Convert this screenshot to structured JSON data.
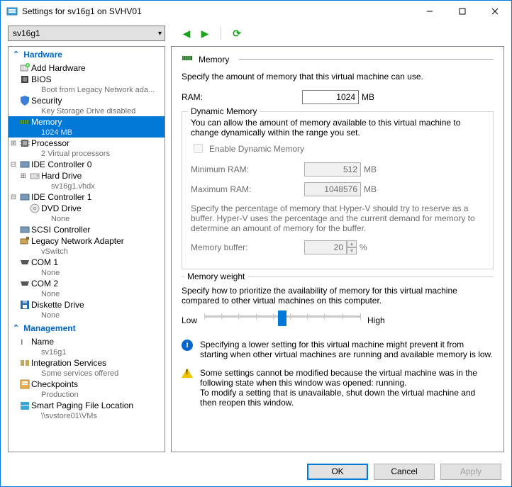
{
  "window": {
    "title": "Settings for sv16g1 on SVHV01"
  },
  "toolbar": {
    "selected_vm": "sv16g1"
  },
  "sections": {
    "hardware": "Hardware",
    "management": "Management"
  },
  "tree": {
    "add_hardware": "Add Hardware",
    "bios": "BIOS",
    "bios_sub": "Boot from Legacy Network ada...",
    "security": "Security",
    "security_sub": "Key Storage Drive disabled",
    "memory": "Memory",
    "memory_sub": "1024 MB",
    "processor": "Processor",
    "processor_sub": "2 Virtual processors",
    "ide0": "IDE Controller 0",
    "hard_drive": "Hard Drive",
    "hard_drive_sub": "sv16g1.vhdx",
    "ide1": "IDE Controller 1",
    "dvd": "DVD Drive",
    "dvd_sub": "None",
    "scsi": "SCSI Controller",
    "legacy_net": "Legacy Network Adapter",
    "legacy_net_sub": "vSwitch",
    "com1": "COM 1",
    "com1_sub": "None",
    "com2": "COM 2",
    "com2_sub": "None",
    "diskette": "Diskette Drive",
    "diskette_sub": "None",
    "name": "Name",
    "name_sub": "sv16g1",
    "integration": "Integration Services",
    "integration_sub": "Some services offered",
    "checkpoints": "Checkpoints",
    "checkpoints_sub": "Production",
    "smart_paging": "Smart Paging File Location",
    "smart_paging_sub": "\\\\svstore01\\VMs"
  },
  "panel": {
    "title": "Memory",
    "intro": "Specify the amount of memory that this virtual machine can use.",
    "ram_label": "RAM:",
    "ram_value": "1024",
    "ram_unit": "MB",
    "dyn_group": "Dynamic Memory",
    "dyn_intro": "You can allow the amount of memory available to this virtual machine to change dynamically within the range you set.",
    "enable_dyn": "Enable Dynamic Memory",
    "min_label": "Minimum RAM:",
    "min_value": "512",
    "min_unit": "MB",
    "max_label": "Maximum RAM:",
    "max_value": "1048576",
    "max_unit": "MB",
    "buffer_intro": "Specify the percentage of memory that Hyper-V should try to reserve as a buffer. Hyper-V uses the percentage and the current demand for memory to determine an amount of memory for the buffer.",
    "buffer_label": "Memory buffer:",
    "buffer_value": "20",
    "buffer_unit": "%",
    "weight_group": "Memory weight",
    "weight_intro": "Specify how to prioritize the availability of memory for this virtual machine compared to other virtual machines on this computer.",
    "low": "Low",
    "high": "High",
    "info": "Specifying a lower setting for this virtual machine might prevent it from starting when other virtual machines are running and available memory is low.",
    "warn": "Some settings cannot be modified because the virtual machine was in the following state when this window was opened: running.\nTo modify a setting that is unavailable, shut down the virtual machine and then reopen this window."
  },
  "buttons": {
    "ok": "OK",
    "cancel": "Cancel",
    "apply": "Apply"
  }
}
